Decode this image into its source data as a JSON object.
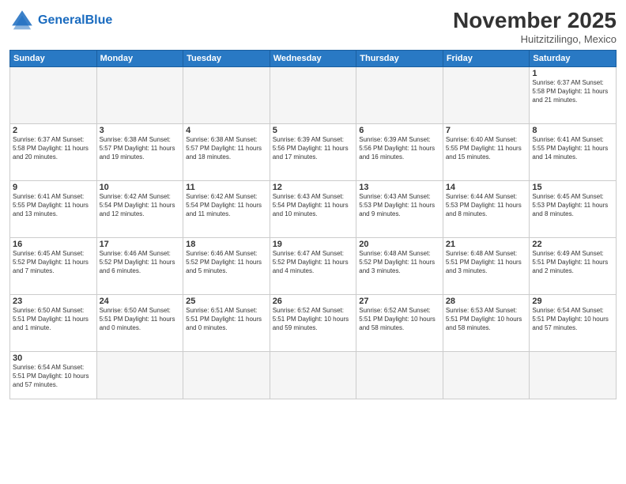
{
  "logo": {
    "general": "General",
    "blue": "Blue"
  },
  "title": "November 2025",
  "subtitle": "Huitzitzilingo, Mexico",
  "days_of_week": [
    "Sunday",
    "Monday",
    "Tuesday",
    "Wednesday",
    "Thursday",
    "Friday",
    "Saturday"
  ],
  "weeks": [
    [
      {
        "day": "",
        "info": "",
        "empty": true
      },
      {
        "day": "",
        "info": "",
        "empty": true
      },
      {
        "day": "",
        "info": "",
        "empty": true
      },
      {
        "day": "",
        "info": "",
        "empty": true
      },
      {
        "day": "",
        "info": "",
        "empty": true
      },
      {
        "day": "",
        "info": "",
        "empty": true
      },
      {
        "day": "1",
        "info": "Sunrise: 6:37 AM\nSunset: 5:58 PM\nDaylight: 11 hours\nand 21 minutes."
      }
    ],
    [
      {
        "day": "2",
        "info": "Sunrise: 6:37 AM\nSunset: 5:58 PM\nDaylight: 11 hours\nand 20 minutes."
      },
      {
        "day": "3",
        "info": "Sunrise: 6:38 AM\nSunset: 5:57 PM\nDaylight: 11 hours\nand 19 minutes."
      },
      {
        "day": "4",
        "info": "Sunrise: 6:38 AM\nSunset: 5:57 PM\nDaylight: 11 hours\nand 18 minutes."
      },
      {
        "day": "5",
        "info": "Sunrise: 6:39 AM\nSunset: 5:56 PM\nDaylight: 11 hours\nand 17 minutes."
      },
      {
        "day": "6",
        "info": "Sunrise: 6:39 AM\nSunset: 5:56 PM\nDaylight: 11 hours\nand 16 minutes."
      },
      {
        "day": "7",
        "info": "Sunrise: 6:40 AM\nSunset: 5:55 PM\nDaylight: 11 hours\nand 15 minutes."
      },
      {
        "day": "8",
        "info": "Sunrise: 6:41 AM\nSunset: 5:55 PM\nDaylight: 11 hours\nand 14 minutes."
      }
    ],
    [
      {
        "day": "9",
        "info": "Sunrise: 6:41 AM\nSunset: 5:55 PM\nDaylight: 11 hours\nand 13 minutes."
      },
      {
        "day": "10",
        "info": "Sunrise: 6:42 AM\nSunset: 5:54 PM\nDaylight: 11 hours\nand 12 minutes."
      },
      {
        "day": "11",
        "info": "Sunrise: 6:42 AM\nSunset: 5:54 PM\nDaylight: 11 hours\nand 11 minutes."
      },
      {
        "day": "12",
        "info": "Sunrise: 6:43 AM\nSunset: 5:54 PM\nDaylight: 11 hours\nand 10 minutes."
      },
      {
        "day": "13",
        "info": "Sunrise: 6:43 AM\nSunset: 5:53 PM\nDaylight: 11 hours\nand 9 minutes."
      },
      {
        "day": "14",
        "info": "Sunrise: 6:44 AM\nSunset: 5:53 PM\nDaylight: 11 hours\nand 8 minutes."
      },
      {
        "day": "15",
        "info": "Sunrise: 6:45 AM\nSunset: 5:53 PM\nDaylight: 11 hours\nand 8 minutes."
      }
    ],
    [
      {
        "day": "16",
        "info": "Sunrise: 6:45 AM\nSunset: 5:52 PM\nDaylight: 11 hours\nand 7 minutes."
      },
      {
        "day": "17",
        "info": "Sunrise: 6:46 AM\nSunset: 5:52 PM\nDaylight: 11 hours\nand 6 minutes."
      },
      {
        "day": "18",
        "info": "Sunrise: 6:46 AM\nSunset: 5:52 PM\nDaylight: 11 hours\nand 5 minutes."
      },
      {
        "day": "19",
        "info": "Sunrise: 6:47 AM\nSunset: 5:52 PM\nDaylight: 11 hours\nand 4 minutes."
      },
      {
        "day": "20",
        "info": "Sunrise: 6:48 AM\nSunset: 5:52 PM\nDaylight: 11 hours\nand 3 minutes."
      },
      {
        "day": "21",
        "info": "Sunrise: 6:48 AM\nSunset: 5:51 PM\nDaylight: 11 hours\nand 3 minutes."
      },
      {
        "day": "22",
        "info": "Sunrise: 6:49 AM\nSunset: 5:51 PM\nDaylight: 11 hours\nand 2 minutes."
      }
    ],
    [
      {
        "day": "23",
        "info": "Sunrise: 6:50 AM\nSunset: 5:51 PM\nDaylight: 11 hours\nand 1 minute."
      },
      {
        "day": "24",
        "info": "Sunrise: 6:50 AM\nSunset: 5:51 PM\nDaylight: 11 hours\nand 0 minutes."
      },
      {
        "day": "25",
        "info": "Sunrise: 6:51 AM\nSunset: 5:51 PM\nDaylight: 11 hours\nand 0 minutes."
      },
      {
        "day": "26",
        "info": "Sunrise: 6:52 AM\nSunset: 5:51 PM\nDaylight: 10 hours\nand 59 minutes."
      },
      {
        "day": "27",
        "info": "Sunrise: 6:52 AM\nSunset: 5:51 PM\nDaylight: 10 hours\nand 58 minutes."
      },
      {
        "day": "28",
        "info": "Sunrise: 6:53 AM\nSunset: 5:51 PM\nDaylight: 10 hours\nand 58 minutes."
      },
      {
        "day": "29",
        "info": "Sunrise: 6:54 AM\nSunset: 5:51 PM\nDaylight: 10 hours\nand 57 minutes."
      }
    ],
    [
      {
        "day": "30",
        "info": "Sunrise: 6:54 AM\nSunset: 5:51 PM\nDaylight: 10 hours\nand 57 minutes.",
        "last": true
      },
      {
        "day": "",
        "info": "",
        "empty": true,
        "last": true
      },
      {
        "day": "",
        "info": "",
        "empty": true,
        "last": true
      },
      {
        "day": "",
        "info": "",
        "empty": true,
        "last": true
      },
      {
        "day": "",
        "info": "",
        "empty": true,
        "last": true
      },
      {
        "day": "",
        "info": "",
        "empty": true,
        "last": true
      },
      {
        "day": "",
        "info": "",
        "empty": true,
        "last": true
      }
    ]
  ]
}
